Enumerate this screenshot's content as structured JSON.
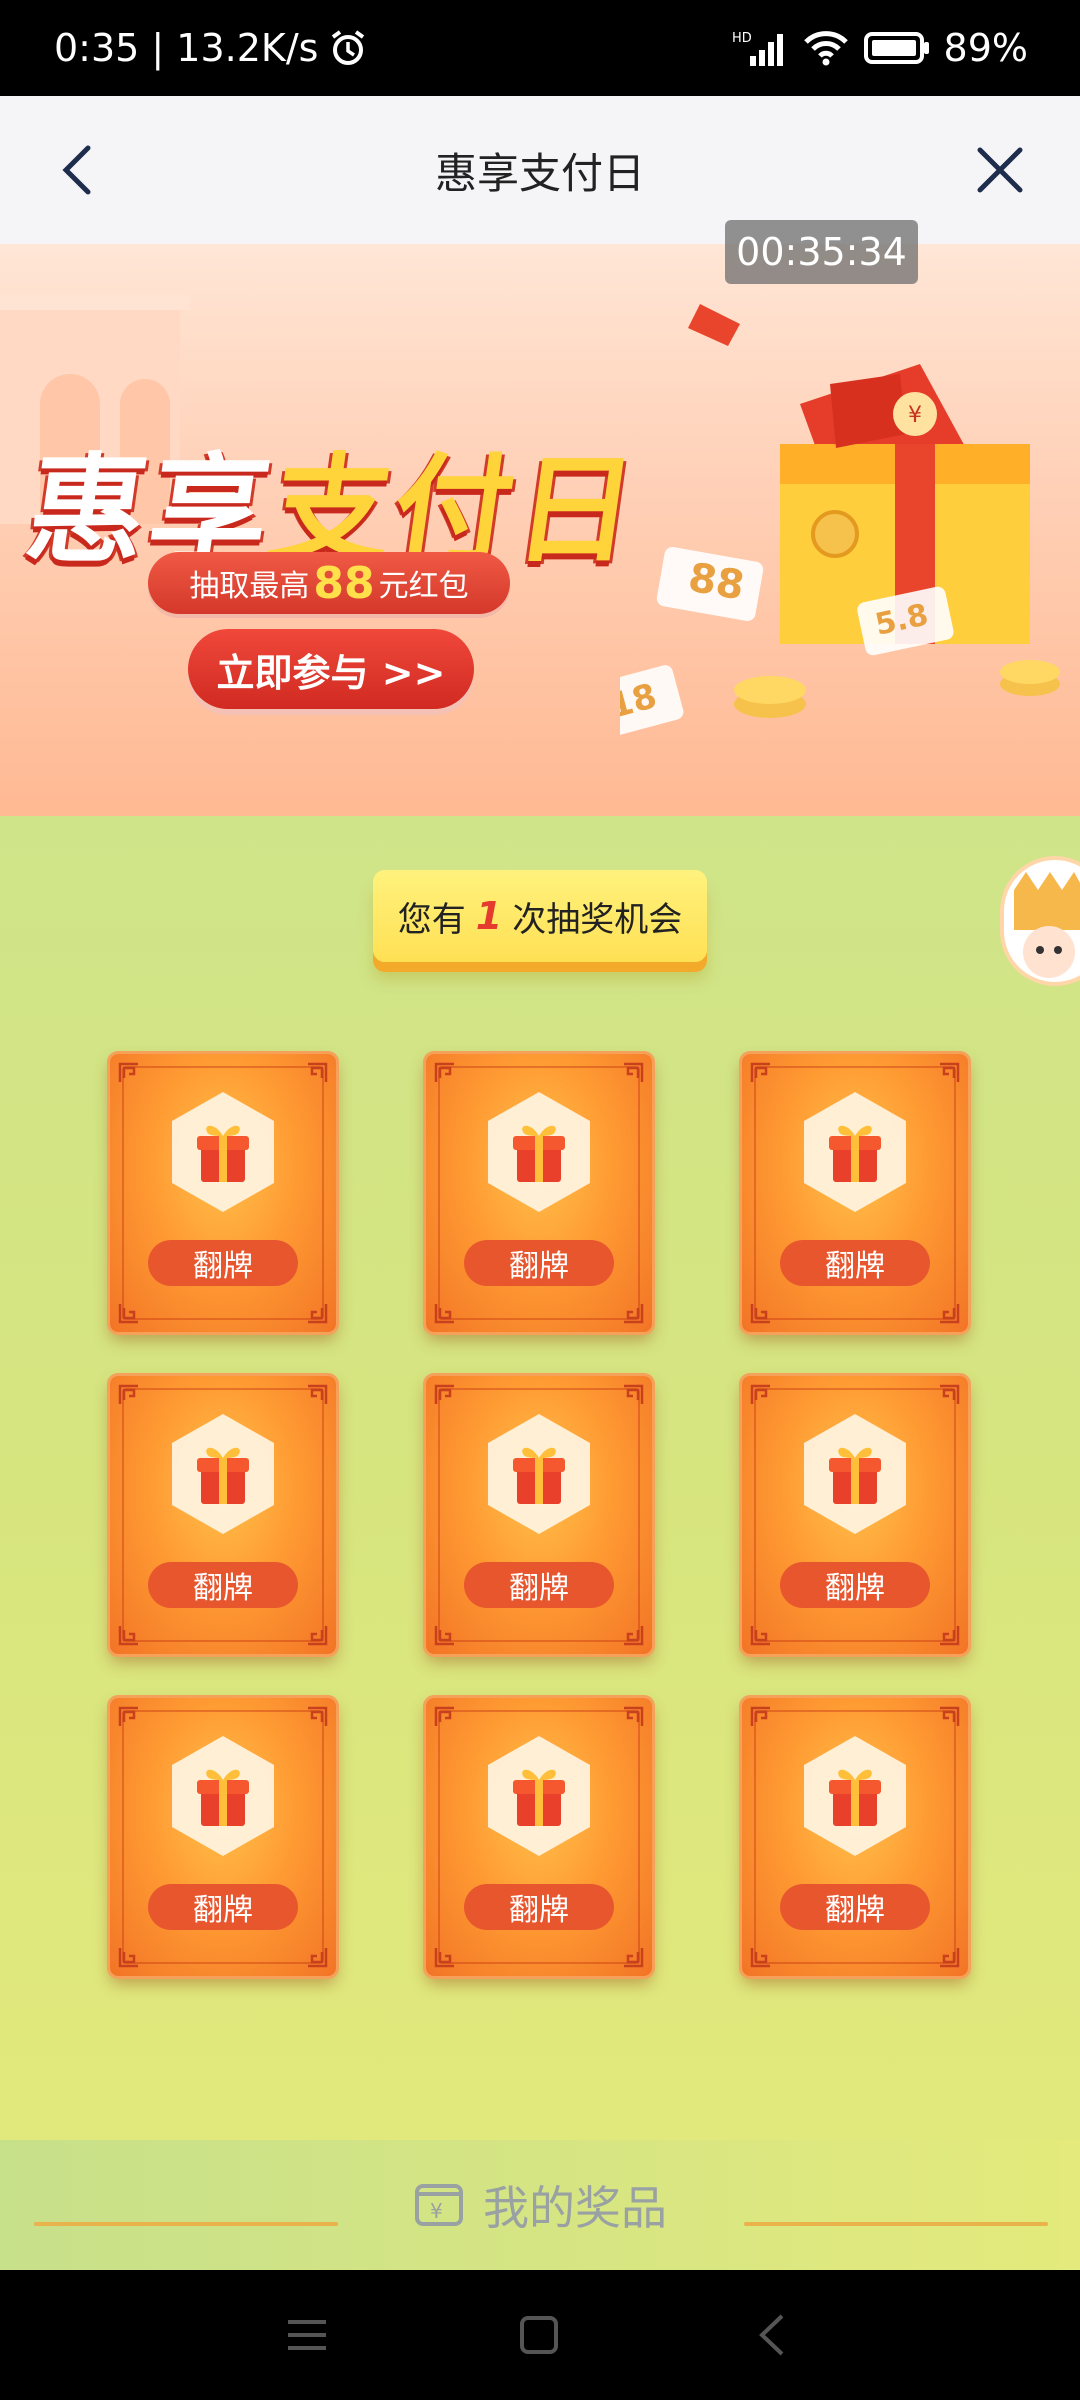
{
  "status_bar": {
    "time_speed": "0:35 | 13.2K/s",
    "battery": "89%",
    "network": "HD"
  },
  "header": {
    "title": "惠享支付日"
  },
  "banner": {
    "timer": "00:35:34",
    "title_part1": "惠享",
    "title_part2": "支付日",
    "subtitle_prefix": "抽取最高",
    "subtitle_amount": "88",
    "subtitle_suffix": "元红包",
    "cta_label": "立即参与 >>",
    "ticket_values": [
      "88",
      "5.8",
      "18"
    ]
  },
  "lottery": {
    "chances_prefix": "您有",
    "chances_count": "1",
    "chances_suffix": "次抽奖机会",
    "cards": [
      {
        "label": "翻牌"
      },
      {
        "label": "翻牌"
      },
      {
        "label": "翻牌"
      },
      {
        "label": "翻牌"
      },
      {
        "label": "翻牌"
      },
      {
        "label": "翻牌"
      },
      {
        "label": "翻牌"
      },
      {
        "label": "翻牌"
      },
      {
        "label": "翻牌"
      }
    ]
  },
  "footer": {
    "my_prizes_label": "我的奖品"
  },
  "colors": {
    "accent_red": "#e53a2e",
    "card_orange": "#f27426",
    "background_green": "#d7e57f"
  }
}
